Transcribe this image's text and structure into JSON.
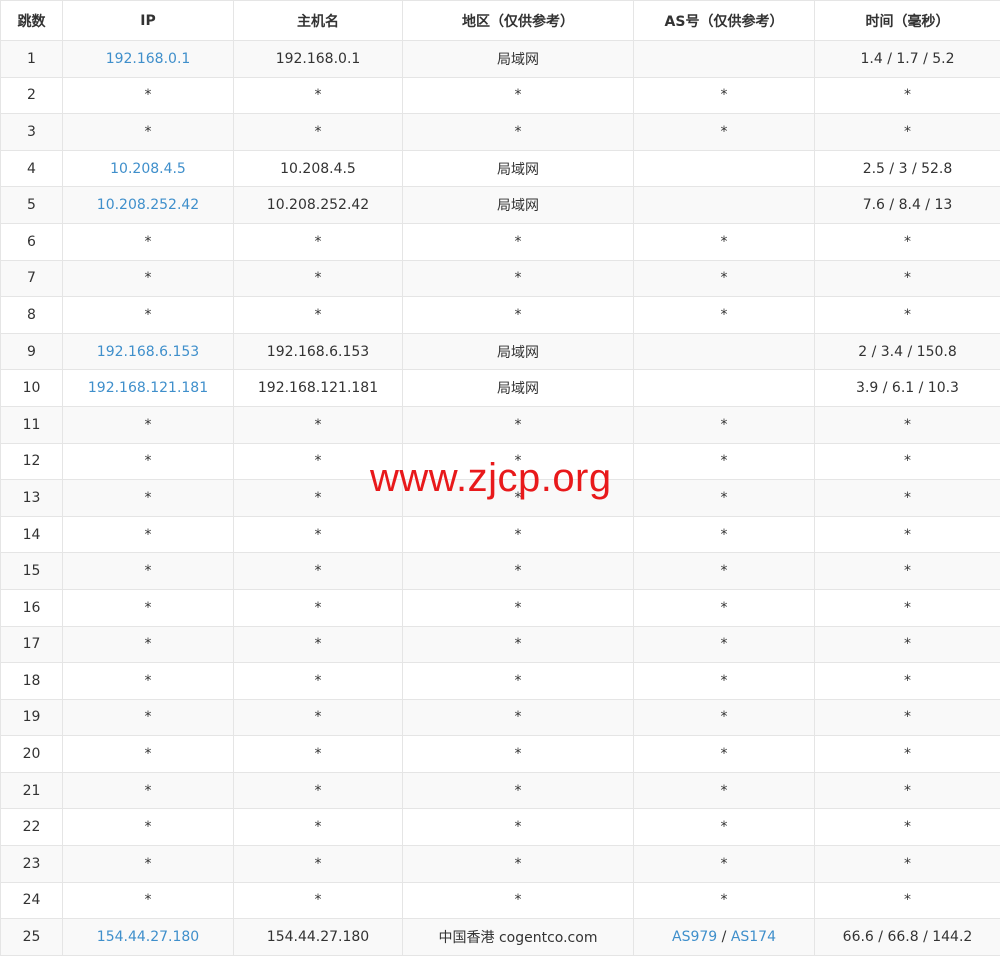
{
  "headers": {
    "hop": "跳数",
    "ip": "IP",
    "hostname": "主机名",
    "region": "地区（仅供参考）",
    "as": "AS号（仅供参考）",
    "time": "时间（毫秒）"
  },
  "rows": [
    {
      "hop": "1",
      "ip": "192.168.0.1",
      "hostname": "192.168.0.1",
      "region": "局域网",
      "as": [],
      "time": "1.4 / 1.7 / 5.2"
    },
    {
      "hop": "2",
      "ip": "*",
      "hostname": "*",
      "region": "*",
      "as": [
        "*"
      ],
      "time": "*"
    },
    {
      "hop": "3",
      "ip": "*",
      "hostname": "*",
      "region": "*",
      "as": [
        "*"
      ],
      "time": "*"
    },
    {
      "hop": "4",
      "ip": "10.208.4.5",
      "hostname": "10.208.4.5",
      "region": "局域网",
      "as": [],
      "time": "2.5 / 3 / 52.8"
    },
    {
      "hop": "5",
      "ip": "10.208.252.42",
      "hostname": "10.208.252.42",
      "region": "局域网",
      "as": [],
      "time": "7.6 / 8.4 / 13"
    },
    {
      "hop": "6",
      "ip": "*",
      "hostname": "*",
      "region": "*",
      "as": [
        "*"
      ],
      "time": "*"
    },
    {
      "hop": "7",
      "ip": "*",
      "hostname": "*",
      "region": "*",
      "as": [
        "*"
      ],
      "time": "*"
    },
    {
      "hop": "8",
      "ip": "*",
      "hostname": "*",
      "region": "*",
      "as": [
        "*"
      ],
      "time": "*"
    },
    {
      "hop": "9",
      "ip": "192.168.6.153",
      "hostname": "192.168.6.153",
      "region": "局域网",
      "as": [],
      "time": "2 / 3.4 / 150.8"
    },
    {
      "hop": "10",
      "ip": "192.168.121.181",
      "hostname": "192.168.121.181",
      "region": "局域网",
      "as": [],
      "time": "3.9 / 6.1 / 10.3"
    },
    {
      "hop": "11",
      "ip": "*",
      "hostname": "*",
      "region": "*",
      "as": [
        "*"
      ],
      "time": "*"
    },
    {
      "hop": "12",
      "ip": "*",
      "hostname": "*",
      "region": "*",
      "as": [
        "*"
      ],
      "time": "*"
    },
    {
      "hop": "13",
      "ip": "*",
      "hostname": "*",
      "region": "*",
      "as": [
        "*"
      ],
      "time": "*"
    },
    {
      "hop": "14",
      "ip": "*",
      "hostname": "*",
      "region": "*",
      "as": [
        "*"
      ],
      "time": "*"
    },
    {
      "hop": "15",
      "ip": "*",
      "hostname": "*",
      "region": "*",
      "as": [
        "*"
      ],
      "time": "*"
    },
    {
      "hop": "16",
      "ip": "*",
      "hostname": "*",
      "region": "*",
      "as": [
        "*"
      ],
      "time": "*"
    },
    {
      "hop": "17",
      "ip": "*",
      "hostname": "*",
      "region": "*",
      "as": [
        "*"
      ],
      "time": "*"
    },
    {
      "hop": "18",
      "ip": "*",
      "hostname": "*",
      "region": "*",
      "as": [
        "*"
      ],
      "time": "*"
    },
    {
      "hop": "19",
      "ip": "*",
      "hostname": "*",
      "region": "*",
      "as": [
        "*"
      ],
      "time": "*"
    },
    {
      "hop": "20",
      "ip": "*",
      "hostname": "*",
      "region": "*",
      "as": [
        "*"
      ],
      "time": "*"
    },
    {
      "hop": "21",
      "ip": "*",
      "hostname": "*",
      "region": "*",
      "as": [
        "*"
      ],
      "time": "*"
    },
    {
      "hop": "22",
      "ip": "*",
      "hostname": "*",
      "region": "*",
      "as": [
        "*"
      ],
      "time": "*"
    },
    {
      "hop": "23",
      "ip": "*",
      "hostname": "*",
      "region": "*",
      "as": [
        "*"
      ],
      "time": "*"
    },
    {
      "hop": "24",
      "ip": "*",
      "hostname": "*",
      "region": "*",
      "as": [
        "*"
      ],
      "time": "*"
    },
    {
      "hop": "25",
      "ip": "154.44.27.180",
      "hostname": "154.44.27.180",
      "region": "中国香港 cogentco.com",
      "as": [
        "AS979",
        "AS174"
      ],
      "time": "66.6 / 66.8 / 144.2"
    }
  ],
  "watermark": "www.zjcp.org",
  "colors": {
    "link": "#3f8fcb",
    "watermark": "#e8191b",
    "stripe": "#f9f9f9",
    "border": "#e5e5e5"
  }
}
